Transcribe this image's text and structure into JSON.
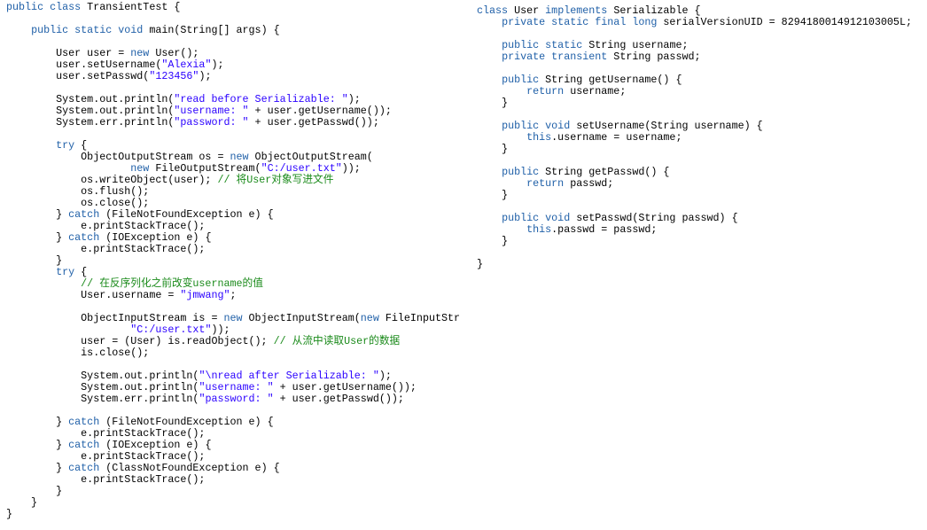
{
  "colors": {
    "keyword": "#2060a8",
    "string": "#2a00ff",
    "comment": "#1a8a1a",
    "plain": "#000000"
  },
  "left_code": [
    [
      [
        "k",
        "public class"
      ],
      [
        "p",
        " TransientTest {"
      ]
    ],
    [],
    [
      [
        "p",
        "    "
      ],
      [
        "k",
        "public static void"
      ],
      [
        "p",
        " main(String[] args) {"
      ]
    ],
    [],
    [
      [
        "p",
        "        User user = "
      ],
      [
        "k",
        "new"
      ],
      [
        "p",
        " User();"
      ]
    ],
    [
      [
        "p",
        "        user.setUsername("
      ],
      [
        "s",
        "\"Alexia\""
      ],
      [
        "p",
        ");"
      ]
    ],
    [
      [
        "p",
        "        user.setPasswd("
      ],
      [
        "s",
        "\"123456\""
      ],
      [
        "p",
        ");"
      ]
    ],
    [],
    [
      [
        "p",
        "        System.out.println("
      ],
      [
        "s",
        "\"read before Serializable: \""
      ],
      [
        "p",
        ");"
      ]
    ],
    [
      [
        "p",
        "        System.out.println("
      ],
      [
        "s",
        "\"username: \""
      ],
      [
        "p",
        " + user.getUsername());"
      ]
    ],
    [
      [
        "p",
        "        System.err.println("
      ],
      [
        "s",
        "\"password: \""
      ],
      [
        "p",
        " + user.getPasswd());"
      ]
    ],
    [],
    [
      [
        "p",
        "        "
      ],
      [
        "k",
        "try"
      ],
      [
        "p",
        " {"
      ]
    ],
    [
      [
        "p",
        "            ObjectOutputStream os = "
      ],
      [
        "k",
        "new"
      ],
      [
        "p",
        " ObjectOutputStream("
      ]
    ],
    [
      [
        "p",
        "                    "
      ],
      [
        "k",
        "new"
      ],
      [
        "p",
        " FileOutputStream("
      ],
      [
        "s",
        "\"C:/user.txt\""
      ],
      [
        "p",
        "));"
      ]
    ],
    [
      [
        "p",
        "            os.writeObject(user); "
      ],
      [
        "c",
        "// 将User对象写进文件"
      ]
    ],
    [
      [
        "p",
        "            os.flush();"
      ]
    ],
    [
      [
        "p",
        "            os.close();"
      ]
    ],
    [
      [
        "p",
        "        } "
      ],
      [
        "k",
        "catch"
      ],
      [
        "p",
        " (FileNotFoundException e) {"
      ]
    ],
    [
      [
        "p",
        "            e.printStackTrace();"
      ]
    ],
    [
      [
        "p",
        "        } "
      ],
      [
        "k",
        "catch"
      ],
      [
        "p",
        " (IOException e) {"
      ]
    ],
    [
      [
        "p",
        "            e.printStackTrace();"
      ]
    ],
    [
      [
        "p",
        "        }"
      ]
    ],
    [
      [
        "p",
        "        "
      ],
      [
        "k",
        "try"
      ],
      [
        "p",
        " {"
      ]
    ],
    [
      [
        "p",
        "            "
      ],
      [
        "c",
        "// 在反序列化之前改变username的值"
      ]
    ],
    [
      [
        "p",
        "            User.username = "
      ],
      [
        "s",
        "\"jmwang\""
      ],
      [
        "p",
        ";"
      ]
    ],
    [],
    [
      [
        "p",
        "            ObjectInputStream is = "
      ],
      [
        "k",
        "new"
      ],
      [
        "p",
        " ObjectInputStream("
      ],
      [
        "k",
        "new"
      ],
      [
        "p",
        " FileInputStr"
      ]
    ],
    [
      [
        "p",
        "                    "
      ],
      [
        "s",
        "\"C:/user.txt\""
      ],
      [
        "p",
        "));"
      ]
    ],
    [
      [
        "p",
        "            user = (User) is.readObject(); "
      ],
      [
        "c",
        "// 从流中读取User的数据"
      ]
    ],
    [
      [
        "p",
        "            is.close();"
      ]
    ],
    [],
    [
      [
        "p",
        "            System.out.println("
      ],
      [
        "s",
        "\"\\nread after Serializable: \""
      ],
      [
        "p",
        ");"
      ]
    ],
    [
      [
        "p",
        "            System.out.println("
      ],
      [
        "s",
        "\"username: \""
      ],
      [
        "p",
        " + user.getUsername());"
      ]
    ],
    [
      [
        "p",
        "            System.err.println("
      ],
      [
        "s",
        "\"password: \""
      ],
      [
        "p",
        " + user.getPasswd());"
      ]
    ],
    [],
    [
      [
        "p",
        "        } "
      ],
      [
        "k",
        "catch"
      ],
      [
        "p",
        " (FileNotFoundException e) {"
      ]
    ],
    [
      [
        "p",
        "            e.printStackTrace();"
      ]
    ],
    [
      [
        "p",
        "        } "
      ],
      [
        "k",
        "catch"
      ],
      [
        "p",
        " (IOException e) {"
      ]
    ],
    [
      [
        "p",
        "            e.printStackTrace();"
      ]
    ],
    [
      [
        "p",
        "        } "
      ],
      [
        "k",
        "catch"
      ],
      [
        "p",
        " (ClassNotFoundException e) {"
      ]
    ],
    [
      [
        "p",
        "            e.printStackTrace();"
      ]
    ],
    [
      [
        "p",
        "        }"
      ]
    ],
    [
      [
        "p",
        "    }"
      ]
    ],
    [
      [
        "p",
        "}"
      ]
    ]
  ],
  "right_code": [
    [
      [
        "k",
        "class"
      ],
      [
        "p",
        " User "
      ],
      [
        "k",
        "implements"
      ],
      [
        "p",
        " Serializable {"
      ]
    ],
    [
      [
        "p",
        "    "
      ],
      [
        "k",
        "private static final long"
      ],
      [
        "p",
        " serialVersionUID = 8294180014912103005L;"
      ]
    ],
    [],
    [
      [
        "p",
        "    "
      ],
      [
        "k",
        "public static"
      ],
      [
        "p",
        " String username;"
      ]
    ],
    [
      [
        "p",
        "    "
      ],
      [
        "k",
        "private transient"
      ],
      [
        "p",
        " String passwd;"
      ]
    ],
    [],
    [
      [
        "p",
        "    "
      ],
      [
        "k",
        "public"
      ],
      [
        "p",
        " String getUsername() {"
      ]
    ],
    [
      [
        "p",
        "        "
      ],
      [
        "k",
        "return"
      ],
      [
        "p",
        " username;"
      ]
    ],
    [
      [
        "p",
        "    }"
      ]
    ],
    [],
    [
      [
        "p",
        "    "
      ],
      [
        "k",
        "public void"
      ],
      [
        "p",
        " setUsername(String username) {"
      ]
    ],
    [
      [
        "p",
        "        "
      ],
      [
        "k",
        "this"
      ],
      [
        "p",
        ".username = username;"
      ]
    ],
    [
      [
        "p",
        "    }"
      ]
    ],
    [],
    [
      [
        "p",
        "    "
      ],
      [
        "k",
        "public"
      ],
      [
        "p",
        " String getPasswd() {"
      ]
    ],
    [
      [
        "p",
        "        "
      ],
      [
        "k",
        "return"
      ],
      [
        "p",
        " passwd;"
      ]
    ],
    [
      [
        "p",
        "    }"
      ]
    ],
    [],
    [
      [
        "p",
        "    "
      ],
      [
        "k",
        "public void"
      ],
      [
        "p",
        " setPasswd(String passwd) {"
      ]
    ],
    [
      [
        "p",
        "        "
      ],
      [
        "k",
        "this"
      ],
      [
        "p",
        ".passwd = passwd;"
      ]
    ],
    [
      [
        "p",
        "    }"
      ]
    ],
    [],
    [
      [
        "p",
        "}"
      ]
    ]
  ]
}
